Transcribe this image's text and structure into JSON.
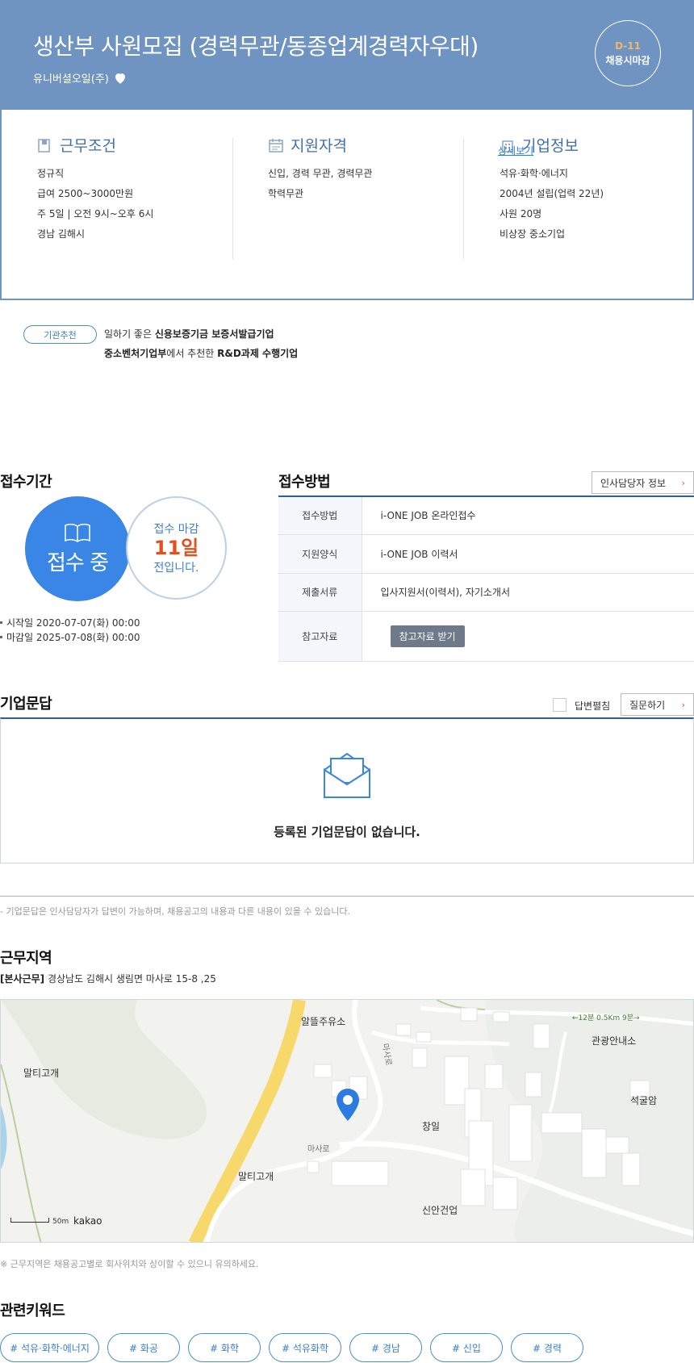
{
  "header": {
    "title": "생산부 사원모집 (경력무관/동종업계경력자우대)",
    "company": "유니버셜오일(주)",
    "dday": "D-11",
    "deadline_type": "채용시마감"
  },
  "info": {
    "work": {
      "title": "근무조건",
      "items": [
        "정규직",
        "급여 2500~3000만원",
        "주 5일 | 오전 9시~오후 6시",
        "경남 김해시"
      ]
    },
    "qual": {
      "title": "지원자격",
      "items": [
        "신입, 경력 무관, 경력무관",
        "학력무관"
      ]
    },
    "corp": {
      "title": "기업정보",
      "items": [
        "석유·화학·에너지",
        "2004년 설립(업력 22년)",
        "사원 20명",
        "비상장 중소기업"
      ],
      "more": "상세보기"
    }
  },
  "recommend": {
    "badge": "기관추천",
    "line1_pre": "일하기 좋은 ",
    "line1_bold": "신용보증기금 보증서발급기업",
    "line2_bold1": "중소벤처기업부",
    "line2_mid": "에서 추천한 ",
    "line2_bold2": "R&D과제 수행기업"
  },
  "period": {
    "title": "접수기간",
    "status": "접수 중",
    "close_prefix": "접수 마감",
    "close_days": "11일",
    "close_suffix": "전입니다.",
    "start": "시작일 2020-07-07(화) 00:00",
    "end": "마감일 2025-07-08(화) 00:00"
  },
  "method": {
    "title": "접수방법",
    "hr_button": "인사담당자 정보",
    "rows": [
      {
        "k": "접수방법",
        "v": "i-ONE JOB 온라인접수"
      },
      {
        "k": "지원양식",
        "v": "i-ONE JOB 이력서"
      },
      {
        "k": "제출서류",
        "v": "입사지원서(이력서), 자기소개서"
      },
      {
        "k": "참고자료",
        "v": "참고자료 받기"
      }
    ]
  },
  "qna": {
    "title": "기업문답",
    "expand_label": "답변펼침",
    "ask_button": "질문하기",
    "empty": "등록된 기업문답이 없습니다.",
    "note": "- 기업문답은 인사담당자가 답변이 가능하며, 채용공고의 내용과 다른 내용이 있을 수 있습니다."
  },
  "area": {
    "title": "근무지역",
    "addr_tag": "[본사근무]",
    "addr": " 경상남도 김해시 생림면 마사로 15-8 ,25",
    "note": "※ 근무지역은 채용공고별로 회사위치와 상이할 수 있으니 유의하세요.",
    "map": {
      "labels": [
        "알뜰주유소",
        "말티고개",
        "마사로",
        "창일",
        "관광안내소",
        "석굴암",
        "말티고개",
        "신안건업",
        "마사로"
      ],
      "scale": "50m",
      "brand": "kakao",
      "road_label": "←12분 0.5Km 9분→"
    }
  },
  "keywords": {
    "title": "관련키워드",
    "items": [
      "# 석유·화학·에너지",
      "# 화공",
      "# 화학",
      "# 석유화학",
      "# 경남",
      "# 신입",
      "# 경력"
    ]
  },
  "colors": {
    "header": "#7094c2",
    "accent": "#3a86e6",
    "navy": "#2f5fa3",
    "orange": "#e84d1c"
  }
}
